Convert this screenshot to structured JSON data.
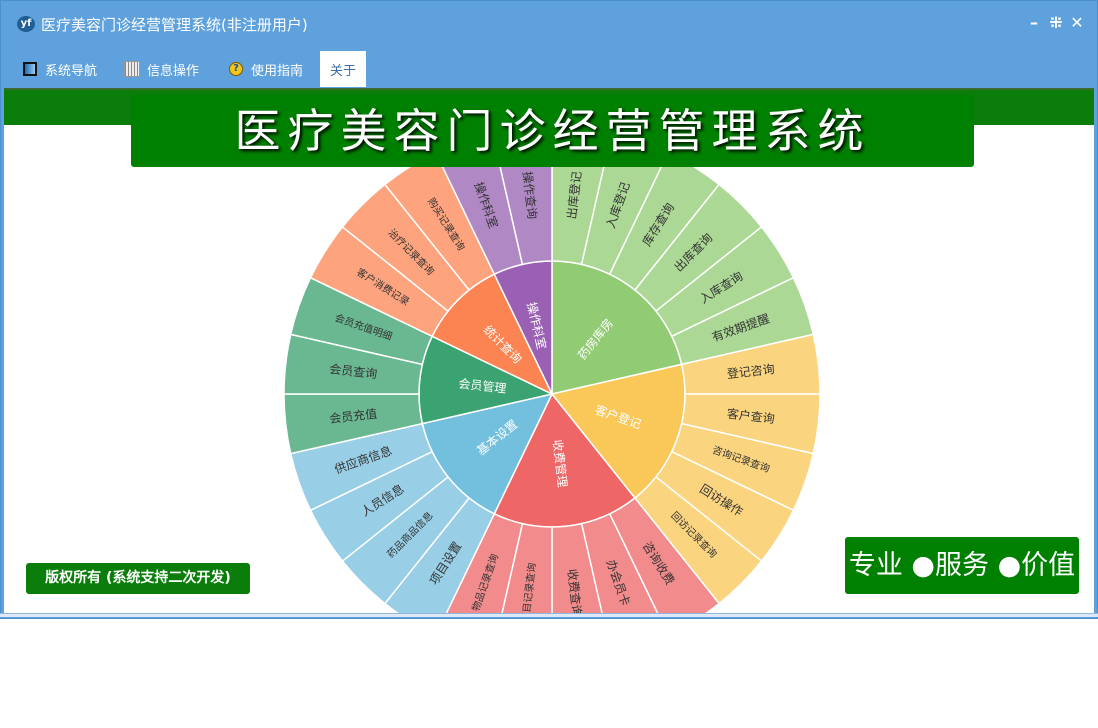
{
  "window": {
    "title": "医疗美容门诊经营管理系统(非注册用户)",
    "app_icon": "yf"
  },
  "window_controls": {
    "minimize": "–",
    "restore": "⁜",
    "close": "✕"
  },
  "menu": [
    {
      "label": "系统导航",
      "icon": "window-icon"
    },
    {
      "label": "信息操作",
      "icon": "grid-icon"
    },
    {
      "label": "使用指南",
      "icon": "help-icon"
    },
    {
      "label": "关于",
      "active": true
    }
  ],
  "banner": {
    "title": "医疗美容门诊经营管理系统"
  },
  "footer": {
    "copyright": "版权所有 (系统支持二次开发)",
    "slogan": "专业 ●服务 ●价值"
  },
  "chart_data": {
    "type": "sunburst",
    "leaf_value": 1,
    "categories": [
      {
        "name": "药房库房",
        "color": "#91cb74",
        "leaf_color": "#acd895",
        "children": [
          "出库登记",
          "入库登记",
          "库存查询",
          "出库查询",
          "入库查询",
          "有效期提醒"
        ]
      },
      {
        "name": "客户登记",
        "color": "#fac858",
        "leaf_color": "#fbd47f",
        "children": [
          "登记咨询",
          "客户查询",
          "咨询记录查询",
          "回访操作",
          "回访记录查询"
        ]
      },
      {
        "name": "收费管理",
        "color": "#ee6666",
        "leaf_color": "#f28b8b",
        "children": [
          "咨询收费",
          "办会员卡",
          "收费查询",
          "项目记录查询",
          "物品记录查询"
        ]
      },
      {
        "name": "基本设置",
        "color": "#73c0de",
        "leaf_color": "#98cfe6",
        "children": [
          "项目设置",
          "药品商品信息",
          "人员信息",
          "供应商信息"
        ]
      },
      {
        "name": "会员管理",
        "color": "#3ba272",
        "leaf_color": "#6ab892",
        "children": [
          "会员充值",
          "会员查询",
          "会员充值明细"
        ]
      },
      {
        "name": "统计查询",
        "color": "#fc8452",
        "leaf_color": "#fda37d",
        "children": [
          "客户消费记录",
          "治疗记录查询",
          "购买记录查询"
        ]
      },
      {
        "name": "操作科室",
        "color": "#9a60b4",
        "leaf_color": "#b088c4",
        "children": [
          "操作科室",
          "操作查询"
        ]
      }
    ]
  }
}
